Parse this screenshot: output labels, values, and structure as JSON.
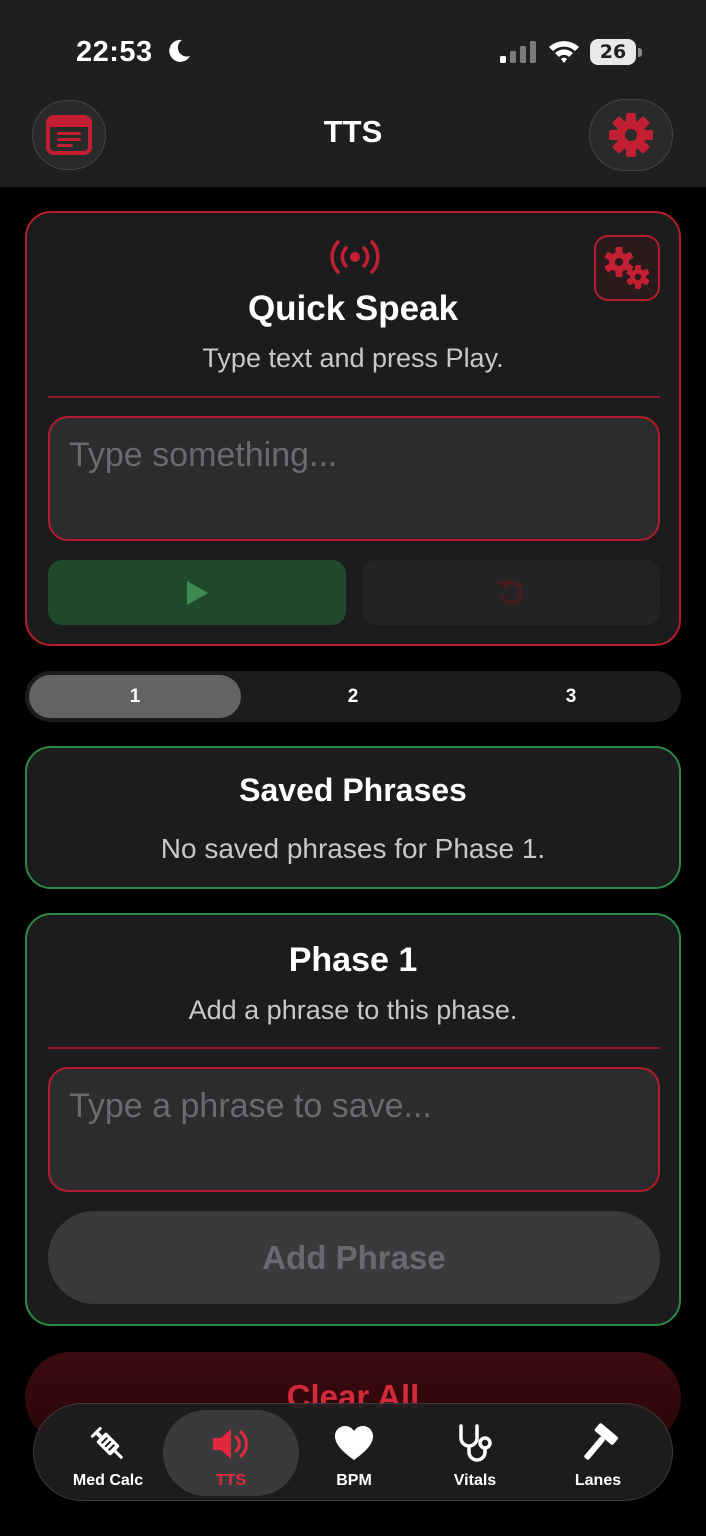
{
  "status_bar": {
    "time": "22:53",
    "battery": "26"
  },
  "header": {
    "title": "TTS",
    "left_icon": "notes-icon",
    "right_icon": "gear-icon"
  },
  "colors": {
    "accent_red": "#b51c2c",
    "accent_green": "#2a8a45",
    "play_green": "#1f4a2c"
  },
  "quick_speak": {
    "title": "Quick Speak",
    "subtitle": "Type text and press Play.",
    "input_placeholder": "Type something...",
    "input_value": "",
    "icons": [
      "broadcast-icon",
      "gears-icon",
      "play-icon",
      "reset-icon"
    ]
  },
  "phase_selector": {
    "options": [
      "1",
      "2",
      "3"
    ],
    "selected": "1"
  },
  "saved_phrases": {
    "title": "Saved Phrases",
    "empty_text": "No saved phrases for Phase 1."
  },
  "phase": {
    "title": "Phase 1",
    "subtitle": "Add a phrase to this phase.",
    "input_placeholder": "Type a phrase to save...",
    "input_value": "",
    "add_label": "Add Phrase"
  },
  "clear_all_label": "Clear All",
  "tabbar": {
    "selected": "TTS",
    "items": [
      {
        "label": "Med Calc",
        "icon": "syringe-icon"
      },
      {
        "label": "TTS",
        "icon": "speaker-icon"
      },
      {
        "label": "BPM",
        "icon": "heart-icon"
      },
      {
        "label": "Vitals",
        "icon": "stethoscope-icon"
      },
      {
        "label": "Lanes",
        "icon": "hammer-icon"
      }
    ]
  }
}
